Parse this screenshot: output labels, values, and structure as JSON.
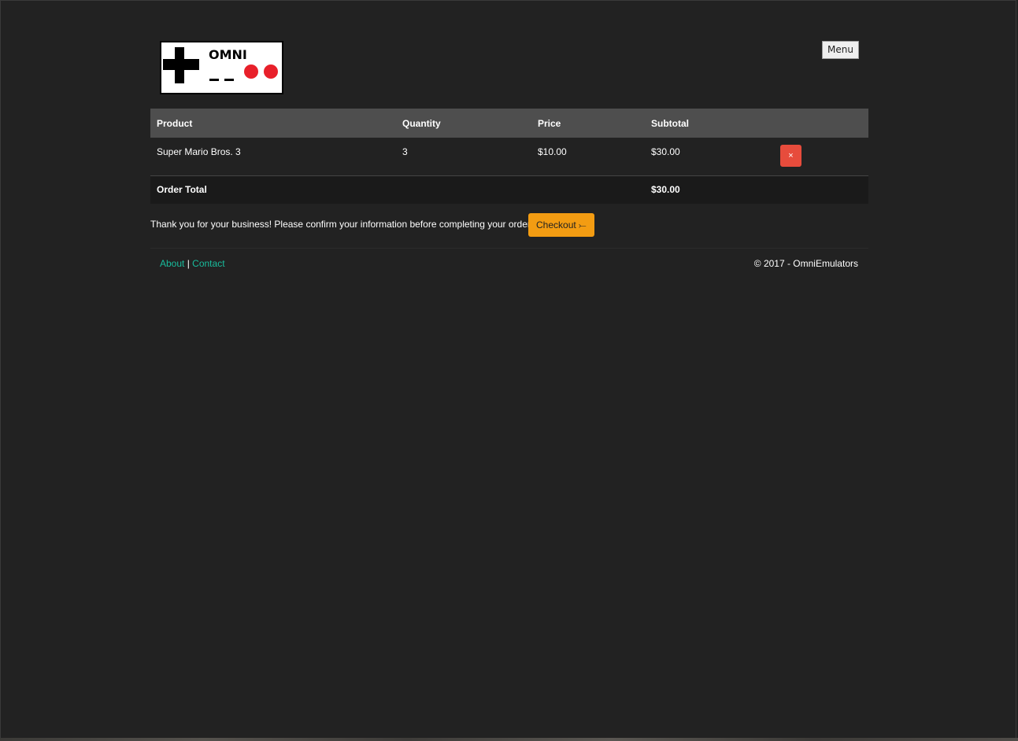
{
  "header": {
    "logo_text": "OMNI",
    "menu_label": "Menu"
  },
  "cart": {
    "columns": [
      "Product",
      "Quantity",
      "Price",
      "Subtotal"
    ],
    "rows": [
      {
        "product": "Super Mario Bros. 3",
        "quantity": "3",
        "price": "$10.00",
        "subtotal": "$30.00",
        "remove_label": "×"
      }
    ],
    "total_label": "Order Total",
    "total_value": "$30.00"
  },
  "checkout": {
    "message": "Thank you for your business! Please confirm your information before completing your order.",
    "button_label": "Checkout ⤚"
  },
  "footer": {
    "about_label": "About",
    "separator": "|",
    "contact_label": "Contact",
    "copyright": "© 2017 - OmniEmulators"
  },
  "colors": {
    "background": "#222222",
    "remove": "#e74c3c",
    "checkout": "#f39c12",
    "link": "#18bc9c"
  }
}
